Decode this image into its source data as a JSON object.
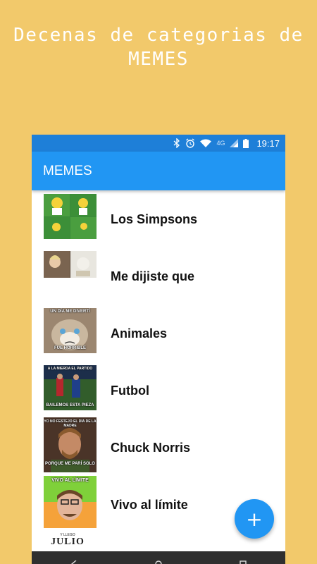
{
  "promo": {
    "line1": "Decenas de categorias de",
    "line2": "MEMES"
  },
  "status_bar": {
    "network": "4G",
    "time": "19:17"
  },
  "app_bar": {
    "title": "MEMES"
  },
  "categories": [
    {
      "label": "Los Simpsons",
      "thumb": "simpsons"
    },
    {
      "label": "Me dijiste que",
      "thumb": "woman-yelling-cat"
    },
    {
      "label": "Animales",
      "thumb": "grumpy-cat",
      "captions": [
        "UN DÍA ME DIVERTÍ",
        "FUE HORRIBLE"
      ]
    },
    {
      "label": "Futbol",
      "thumb": "soccer",
      "captions": [
        "A LA MIERDA EL PARTIDO",
        "BAILEMOS ESTA PIEZA"
      ]
    },
    {
      "label": "Chuck Norris",
      "thumb": "chuck-norris",
      "captions": [
        "YO NO FESTEJO EL DÍA DE LA MADRE",
        "PORQUE ME PARÍ SOLO"
      ]
    },
    {
      "label": "Vivo al límite",
      "thumb": "vivo-al-limite",
      "captions": [
        "VIVO AL LÍMITE"
      ]
    },
    {
      "label": "",
      "thumb": "julio",
      "captions": [
        "Y LLEGÓ",
        "JULIO"
      ]
    }
  ],
  "fab": {
    "icon": "add-icon",
    "symbol": "+"
  },
  "colors": {
    "background": "#F2C96B",
    "status_bar": "#1E7FD8",
    "app_bar": "#2196F3",
    "fab": "#2196F3"
  }
}
